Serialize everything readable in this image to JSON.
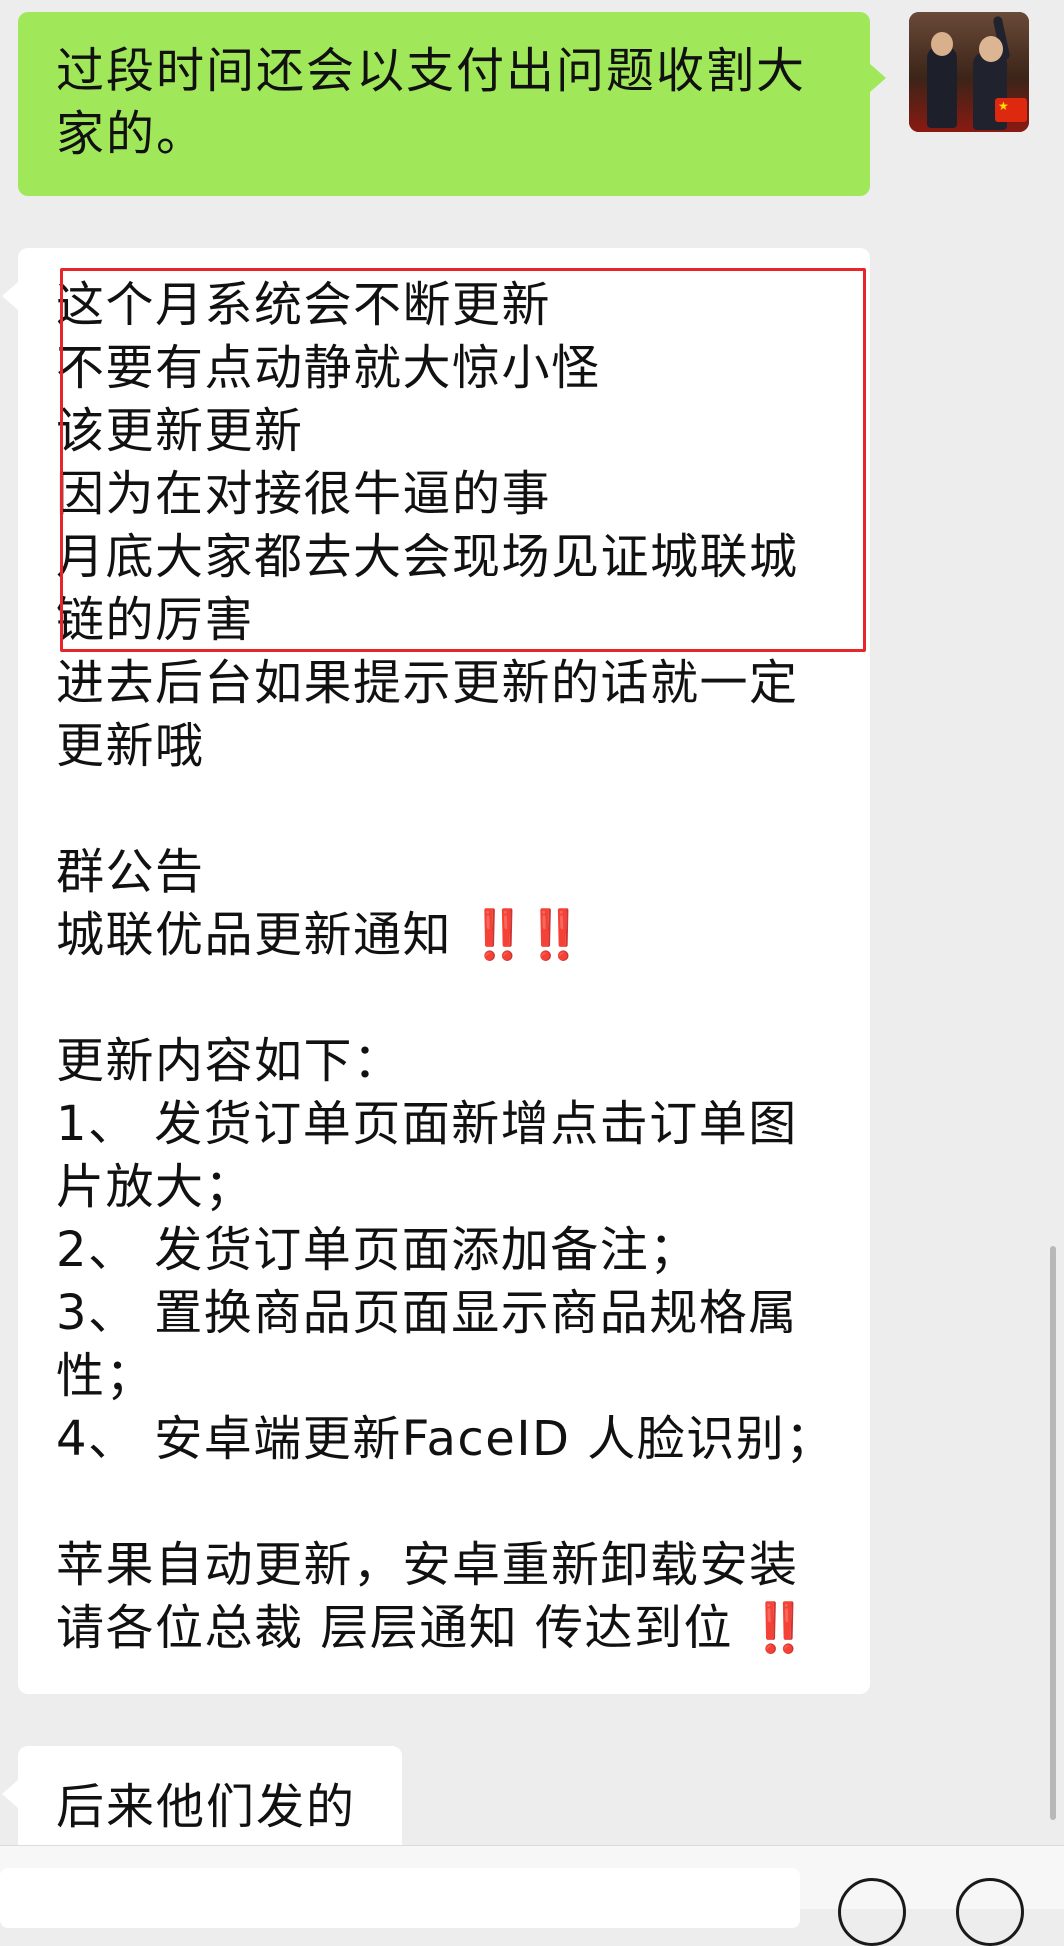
{
  "messages": {
    "outgoing": {
      "lines": [
        "过段时间还会以支付出问题收割大",
        "家的。"
      ]
    },
    "incoming_main": {
      "highlighted_lines": [
        "这个月系统会不断更新",
        "不要有点动静就大惊小怪",
        "该更新更新",
        "因为在对接很牛逼的事",
        "月底大家都去大会现场见证城联城",
        "链的厉害"
      ],
      "lines_after": [
        "进去后台如果提示更新的话就一定",
        "更新哦"
      ],
      "announcement_title": "群公告",
      "announcement_heading": "城联优品更新通知",
      "announcement_marks": "‼️‼️",
      "content_intro": "更新内容如下：",
      "items": [
        "1、 发货订单页面新增点击订单图",
        "片放大；",
        "2、 发货订单页面添加备注；",
        "3、 置换商品页面显示商品规格属",
        "性；",
        "4、 安卓端更新FaceID 人脸识别；"
      ],
      "footer_line1": "苹果自动更新，安卓重新卸载安装",
      "footer_line2": "请各位总裁 层层通知 传达到位",
      "footer_mark": "‼️"
    },
    "incoming_last": {
      "text": "后来他们发的"
    }
  },
  "colors": {
    "outgoing_bubble": "#a0e75a",
    "incoming_bubble": "#ffffff",
    "background": "#ededed",
    "highlight_border": "#e8252b",
    "exclamation": "#e0262c"
  },
  "icons": {
    "avatar": "user-avatar-photo",
    "flag": "china-flag-icon",
    "voice": "voice-toggle-icon",
    "emoji": "emoji-icon"
  }
}
